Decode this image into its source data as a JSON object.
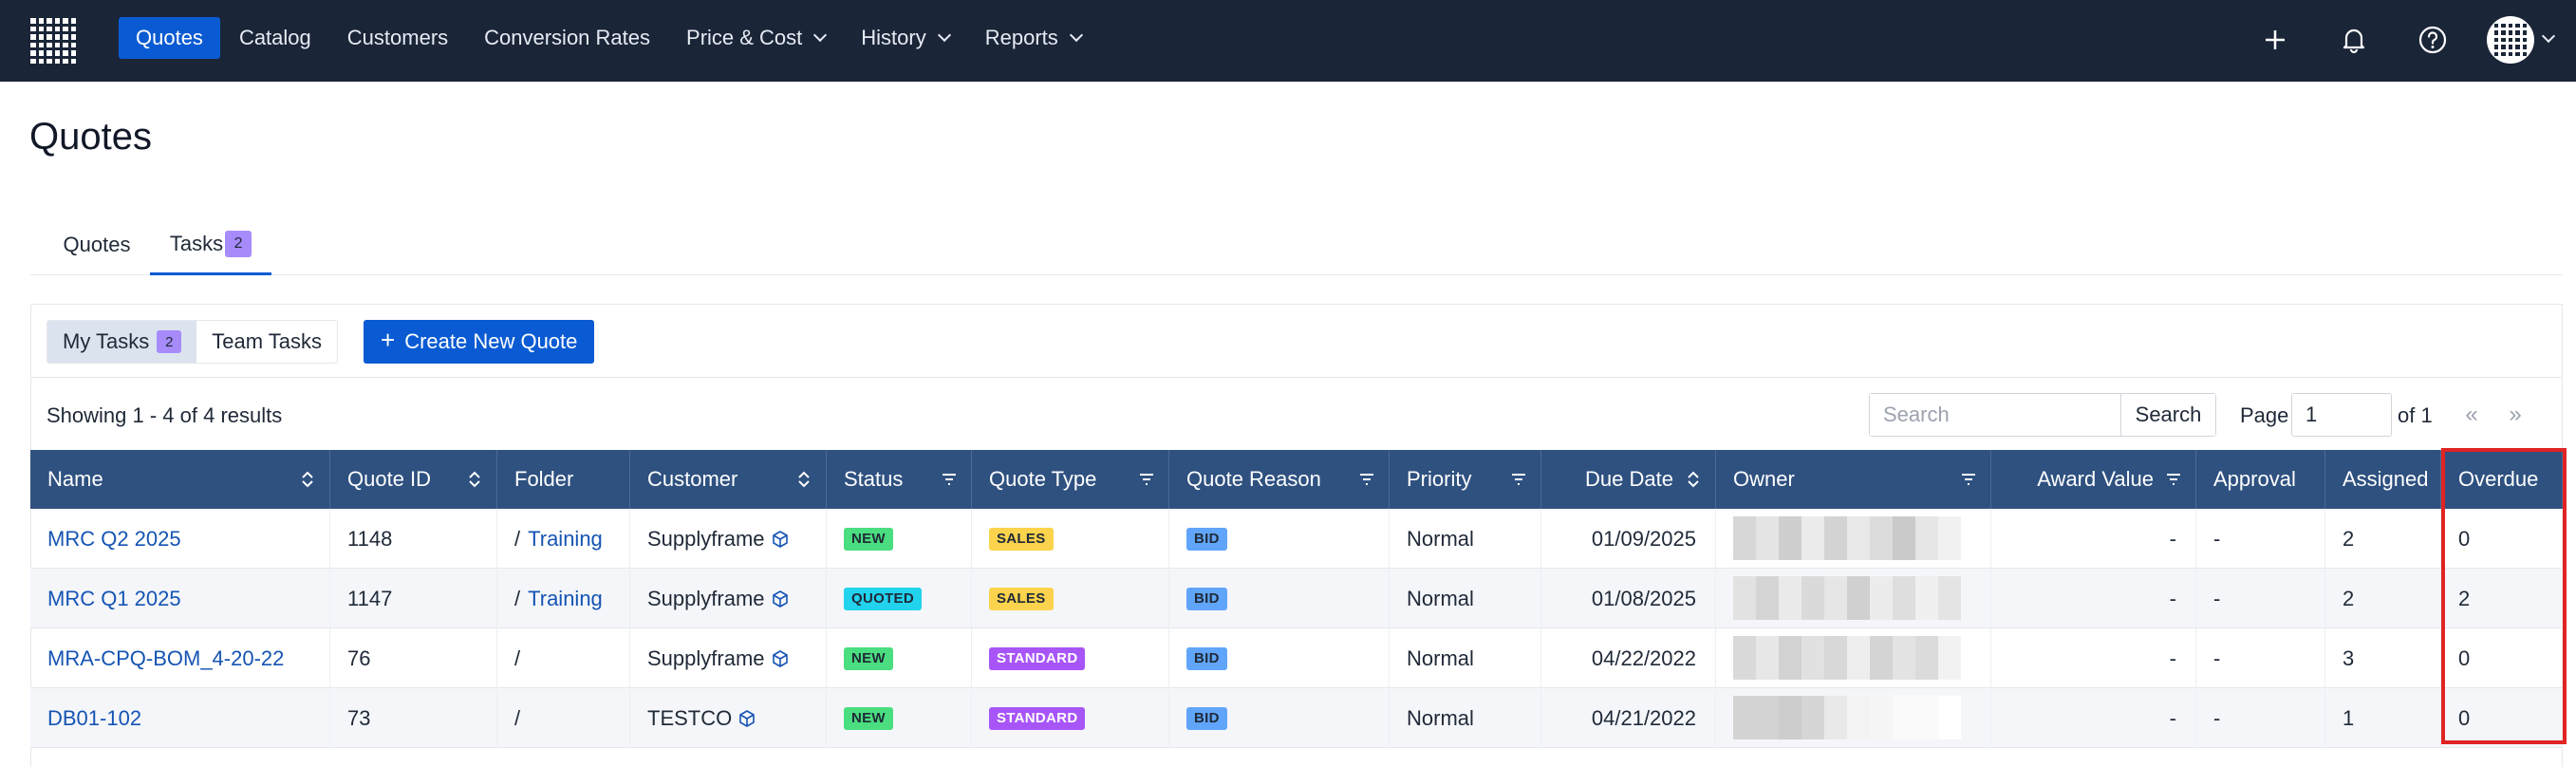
{
  "nav": {
    "items": [
      {
        "label": "Quotes",
        "active": true,
        "dropdown": false
      },
      {
        "label": "Catalog",
        "active": false,
        "dropdown": false
      },
      {
        "label": "Customers",
        "active": false,
        "dropdown": false
      },
      {
        "label": "Conversion Rates",
        "active": false,
        "dropdown": false
      },
      {
        "label": "Price & Cost",
        "active": false,
        "dropdown": true
      },
      {
        "label": "History",
        "active": false,
        "dropdown": true
      },
      {
        "label": "Reports",
        "active": false,
        "dropdown": true
      }
    ],
    "icons": [
      "plus-icon",
      "bell-icon",
      "help-icon",
      "avatar"
    ]
  },
  "page": {
    "title": "Quotes"
  },
  "tabs": [
    {
      "label": "Quotes",
      "active": false
    },
    {
      "label": "Tasks",
      "badge": "2",
      "active": true
    }
  ],
  "toolbar": {
    "my_tasks": "My Tasks",
    "my_tasks_badge": "2",
    "team_tasks": "Team Tasks",
    "create_label": "Create New Quote",
    "create_icon": "+",
    "showing": "Showing 1 - 4 of 4 results",
    "search_placeholder": "Search",
    "search_button": "Search",
    "page_label": "Page",
    "page_value": "1",
    "of_label": "of 1",
    "first_icon": "«",
    "last_icon": "»"
  },
  "table": {
    "columns": [
      {
        "label": "Name",
        "icon": "sort"
      },
      {
        "label": "Quote ID",
        "icon": "sort"
      },
      {
        "label": "Folder",
        "icon": ""
      },
      {
        "label": "Customer",
        "icon": "sort"
      },
      {
        "label": "Status",
        "icon": "filter"
      },
      {
        "label": "Quote Type",
        "icon": "filter"
      },
      {
        "label": "Quote Reason",
        "icon": "filter"
      },
      {
        "label": "Priority",
        "icon": "filter"
      },
      {
        "label": "Due Date",
        "icon": "sort"
      },
      {
        "label": "Owner",
        "icon": "filter"
      },
      {
        "label": "Award Value",
        "icon": "filter"
      },
      {
        "label": "Approval",
        "icon": ""
      },
      {
        "label": "Assigned",
        "icon": ""
      },
      {
        "label": "Overdue",
        "icon": ""
      }
    ],
    "rows": [
      {
        "name": "MRC Q2 2025",
        "quote_id": "1148",
        "folder_sep": "/",
        "folder": "Training",
        "customer": "Supplyframe",
        "status": "NEW",
        "quote_type": "SALES",
        "quote_reason": "BID",
        "priority": "Normal",
        "due_date": "01/09/2025",
        "award_value": "-",
        "approval": "-",
        "assigned": "2",
        "overdue": "0"
      },
      {
        "name": "MRC Q1 2025",
        "quote_id": "1147",
        "folder_sep": "/",
        "folder": "Training",
        "customer": "Supplyframe",
        "status": "QUOTED",
        "quote_type": "SALES",
        "quote_reason": "BID",
        "priority": "Normal",
        "due_date": "01/08/2025",
        "award_value": "-",
        "approval": "-",
        "assigned": "2",
        "overdue": "2"
      },
      {
        "name": "MRA-CPQ-BOM_4-20-22",
        "quote_id": "76",
        "folder_sep": "/",
        "folder": "",
        "customer": "Supplyframe",
        "status": "NEW",
        "quote_type": "STANDARD",
        "quote_reason": "BID",
        "priority": "Normal",
        "due_date": "04/22/2022",
        "award_value": "-",
        "approval": "-",
        "assigned": "3",
        "overdue": "0"
      },
      {
        "name": "DB01-102",
        "quote_id": "73",
        "folder_sep": "/",
        "folder": "",
        "customer": "TESTCO",
        "status": "NEW",
        "quote_type": "STANDARD",
        "quote_reason": "BID",
        "priority": "Normal",
        "due_date": "04/21/2022",
        "award_value": "-",
        "approval": "-",
        "assigned": "1",
        "overdue": "0"
      }
    ]
  },
  "colors": {
    "nav_bg": "#1b2538",
    "accent": "#0a5bd3",
    "table_header": "#2f5180",
    "highlight": "#e02424"
  }
}
